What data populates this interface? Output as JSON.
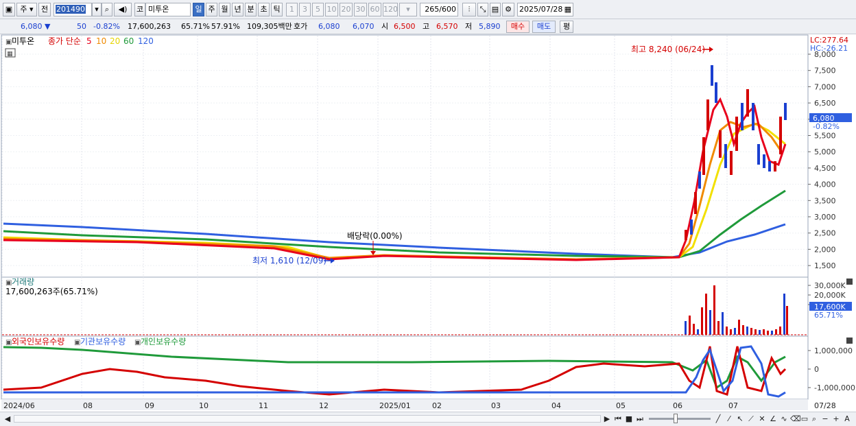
{
  "toolbar": {
    "market_label": "주",
    "prev_label": "전",
    "code_value": "201490",
    "co_label": "코",
    "name_value": "미투온",
    "periods": [
      "일",
      "주",
      "월",
      "년",
      "분",
      "초",
      "틱"
    ],
    "active_period": "일",
    "intervals": [
      "1",
      "3",
      "5",
      "10",
      "20",
      "30",
      "60",
      "120"
    ],
    "count_value": "265",
    "count_max": "/600",
    "date_value": "2025/07/28"
  },
  "quote": {
    "price": "6,080",
    "change": "50",
    "change_pct": "-0.82%",
    "volume": "17,600,263",
    "vol_ratio": "65.71%",
    "turnover": "57.91%",
    "amount": "109,305백만",
    "hoga_label": "호가",
    "ask": "6,080",
    "bid": "6,070",
    "open_label": "시",
    "open": "6,500",
    "high_label": "고",
    "high": "6,570",
    "low_label": "저",
    "low": "5,890",
    "buy_label": "매수",
    "sell_label": "매도",
    "eval_label": "평"
  },
  "price_panel": {
    "stock_name": "미투온",
    "ma_title": "종가 단순",
    "ma_periods": [
      {
        "label": "5",
        "color": "#e8001c"
      },
      {
        "label": "10",
        "color": "#f08a00"
      },
      {
        "label": "20",
        "color": "#f2e000"
      },
      {
        "label": "60",
        "color": "#1f9a3a"
      },
      {
        "label": "120",
        "color": "#2f5fe0"
      }
    ],
    "lc_label": "LC:277.64",
    "hc_label": "HC:-26.21",
    "high_annotation": "최고 8,240 (06/24)",
    "low_annotation": "최저 1,610 (12/09)",
    "dividend_annotation": "배당락(0.00%)",
    "y_ticks": [
      "8,000",
      "7,500",
      "7,000",
      "6,500",
      "6,000",
      "5,500",
      "5,000",
      "4,500",
      "4,000",
      "3,500",
      "3,000",
      "2,500",
      "2,000",
      "1,500"
    ],
    "current_price": "6,080",
    "current_pct": "-0.82%"
  },
  "volume_panel": {
    "title": "거래량",
    "value": "17,600,263주(65.71%)",
    "y_ticks": [
      "30,000K",
      "20,000K",
      "10,000K"
    ],
    "current": "17,600K",
    "current_pct": "65.71%"
  },
  "holdings_panel": {
    "series": [
      {
        "name": "외국인보유수량",
        "color": "#d40000"
      },
      {
        "name": "기관보유수량",
        "color": "#2f5fe0"
      },
      {
        "name": "개인보유수량",
        "color": "#1f9a3a"
      }
    ],
    "y_ticks": [
      "1,000,000",
      "0",
      "-1,000,000"
    ]
  },
  "x_axis": {
    "labels": [
      "2024/06",
      "08",
      "09",
      "10",
      "11",
      "12",
      "2025/01",
      "02",
      "03",
      "04",
      "05",
      "06",
      "07",
      "07/28"
    ]
  },
  "colors": {
    "up": "#d40000",
    "down": "#1a3fd0",
    "current_tag": "#2f5fe0"
  }
}
